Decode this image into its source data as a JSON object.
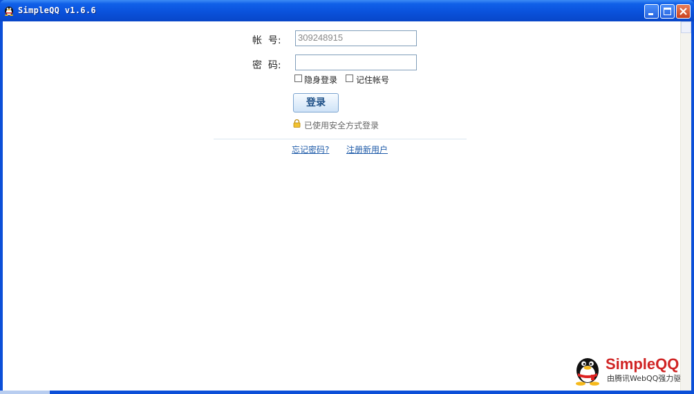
{
  "window": {
    "title": "SimpleQQ v1.6.6"
  },
  "form": {
    "account_label": "帐  号:",
    "account_value": "309248915",
    "password_label": "密  码:",
    "password_value": "",
    "invisible_login_label": "隐身登录",
    "remember_account_label": "记住帐号",
    "login_button": "登录",
    "secure_text": "已使用安全方式登录"
  },
  "links": {
    "forgot_password": "忘记密码?",
    "register": "注册新用户"
  },
  "brand": {
    "name": "SimpleQQ",
    "tagline": "由腾讯WebQQ强力驱动"
  },
  "colors": {
    "titlebar": "#0a52dc",
    "brand_red": "#d02424",
    "link": "#1d5aa8"
  }
}
